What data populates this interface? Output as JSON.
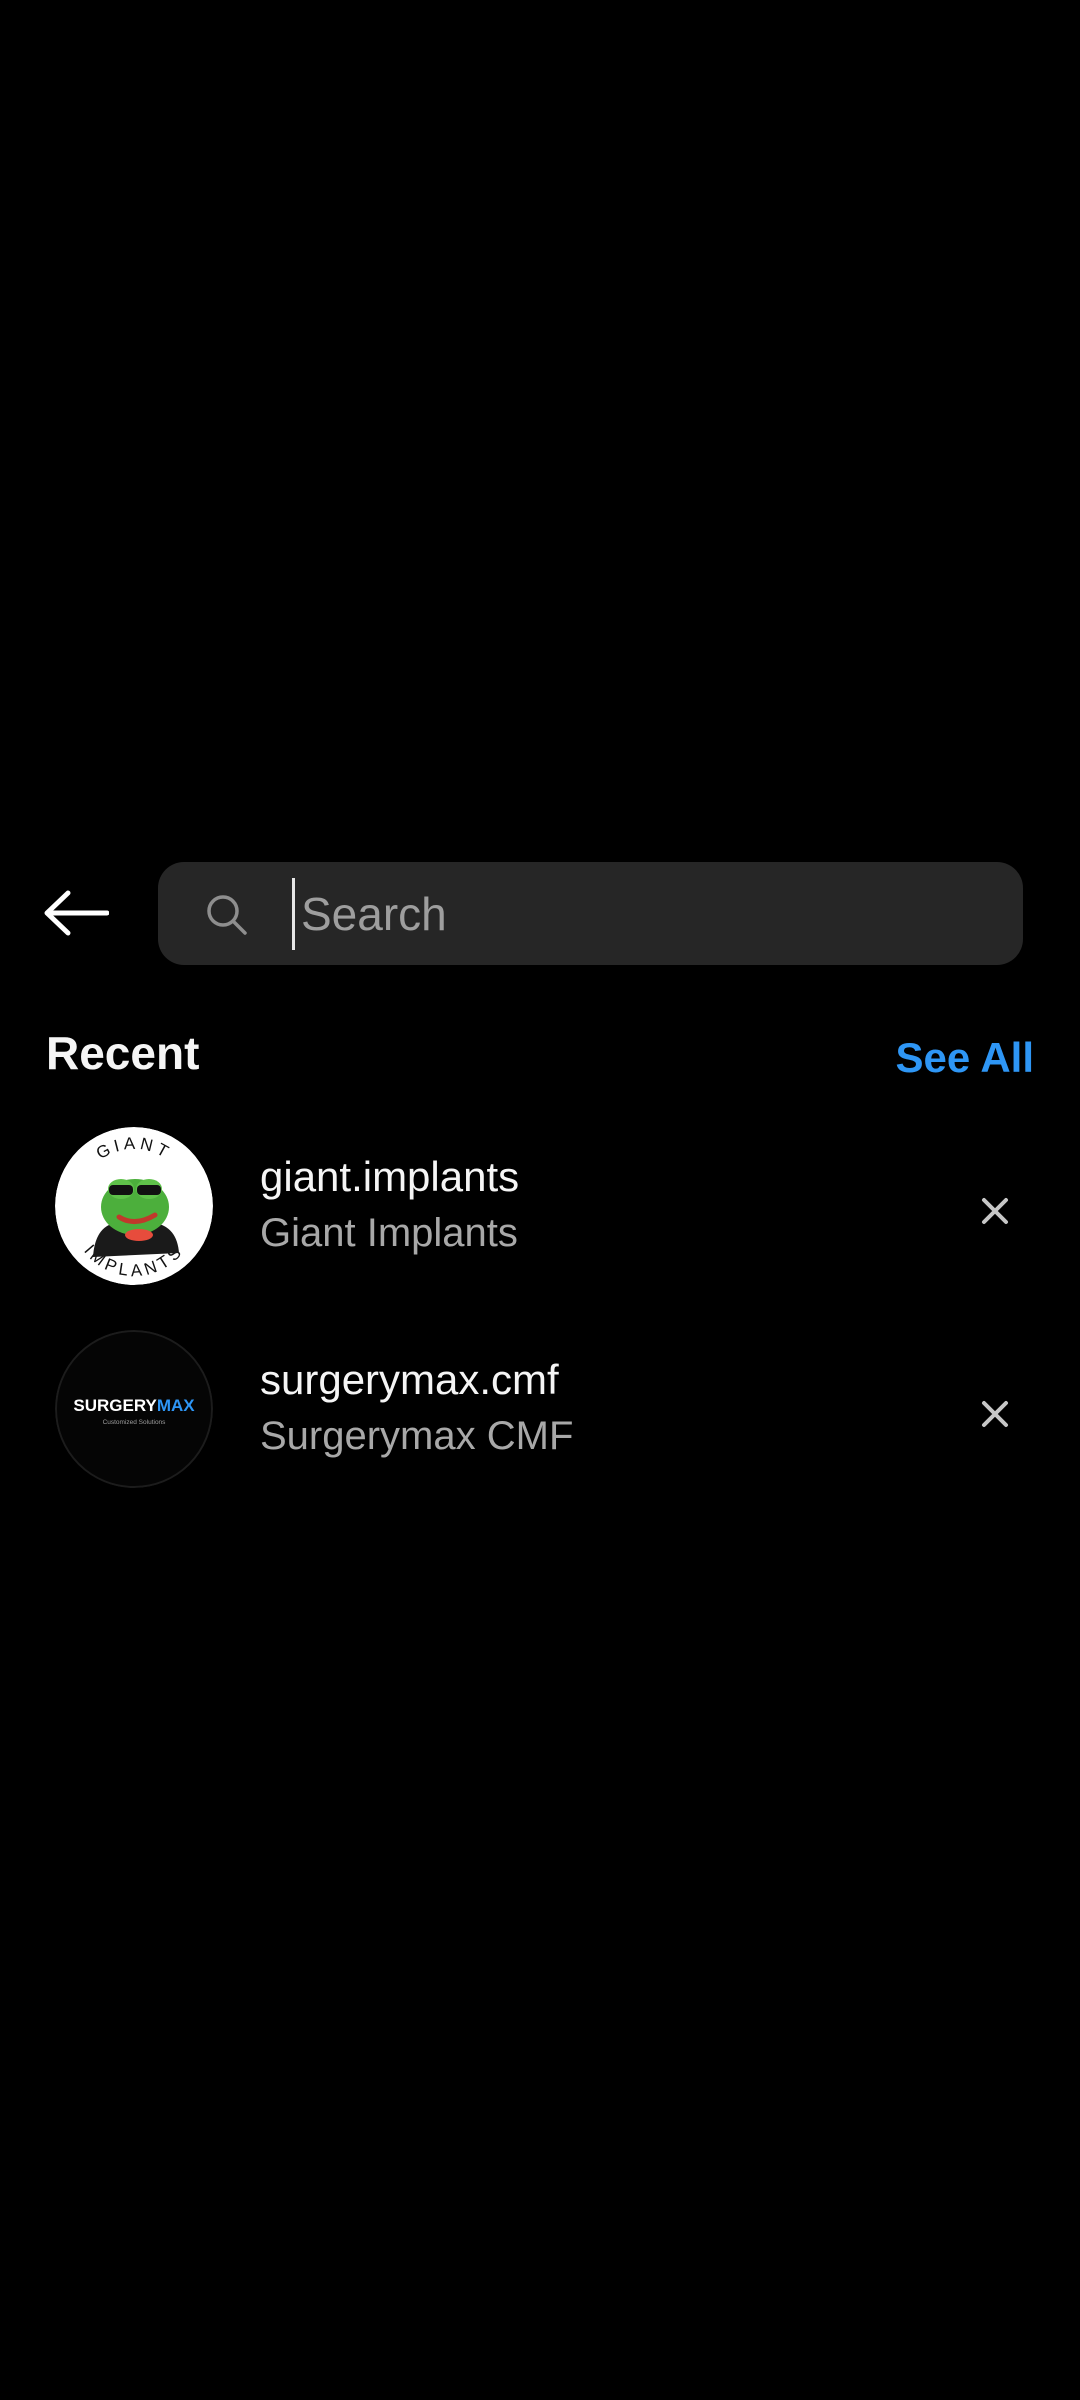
{
  "search": {
    "back_icon": "arrow-left-icon",
    "search_icon": "search-icon",
    "placeholder": "Search",
    "value": ""
  },
  "recent": {
    "title": "Recent",
    "see_all_label": "See All",
    "items": [
      {
        "username": "giant.implants",
        "fullname": "Giant Implants",
        "avatar_text_top": "GIANT",
        "avatar_text_bottom": "IMPLANTS",
        "remove_icon": "close-icon"
      },
      {
        "username": "surgerymax.cmf",
        "fullname": "Surgerymax CMF",
        "avatar_brand_a": "SURGERY",
        "avatar_brand_b": "MAX",
        "avatar_tagline": "Customized Solutions",
        "remove_icon": "close-icon"
      }
    ]
  },
  "colors": {
    "background": "#000000",
    "search_bg": "#262626",
    "accent": "#2e96f5",
    "primary_text": "#f5f5f5",
    "secondary_text": "#a8a8a8"
  }
}
